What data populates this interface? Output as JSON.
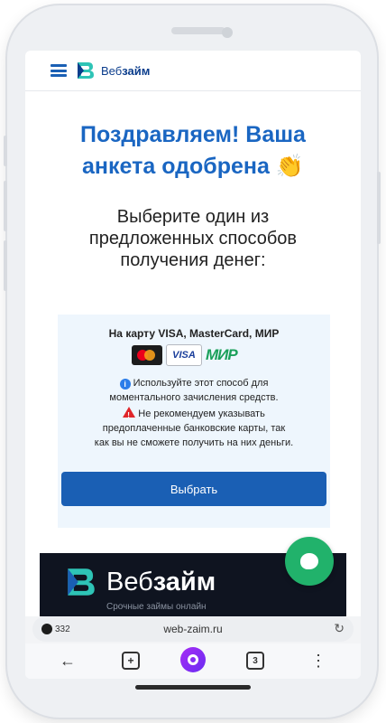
{
  "header": {
    "brand_prefix": "Веб",
    "brand_suffix": "займ"
  },
  "main": {
    "title_line1": "Поздравляем! Ваша",
    "title_line2": "анкета одобрена 👏",
    "subtitle_line1": "Выберите один из",
    "subtitle_line2": "предложенных способов",
    "subtitle_line3": "получения денег:"
  },
  "card": {
    "title": "На карту VISA, MasterCard, МИР",
    "visa_label": "VISA",
    "mir_label": "МИР",
    "info_line1": "Используйте этот способ для",
    "info_line2": "моментального зачисления средств.",
    "warn_line1": "Не рекомендуем указывать",
    "warn_line2": "предоплаченные банковские карты, так",
    "warn_line3": "как вы не сможете получить на них деньги.",
    "button_label": "Выбрать"
  },
  "banner": {
    "brand_prefix": "Веб",
    "brand_suffix": "займ",
    "tagline": "Срочные займы онлайн"
  },
  "browser": {
    "tab_count_badge": "332",
    "url": "web-zaim.ru",
    "tabs_count": "3"
  },
  "colors": {
    "accent": "#1a5fb4",
    "title_blue": "#1a66c2",
    "chat_green": "#21b26b",
    "banner_dark": "#0f1420"
  }
}
